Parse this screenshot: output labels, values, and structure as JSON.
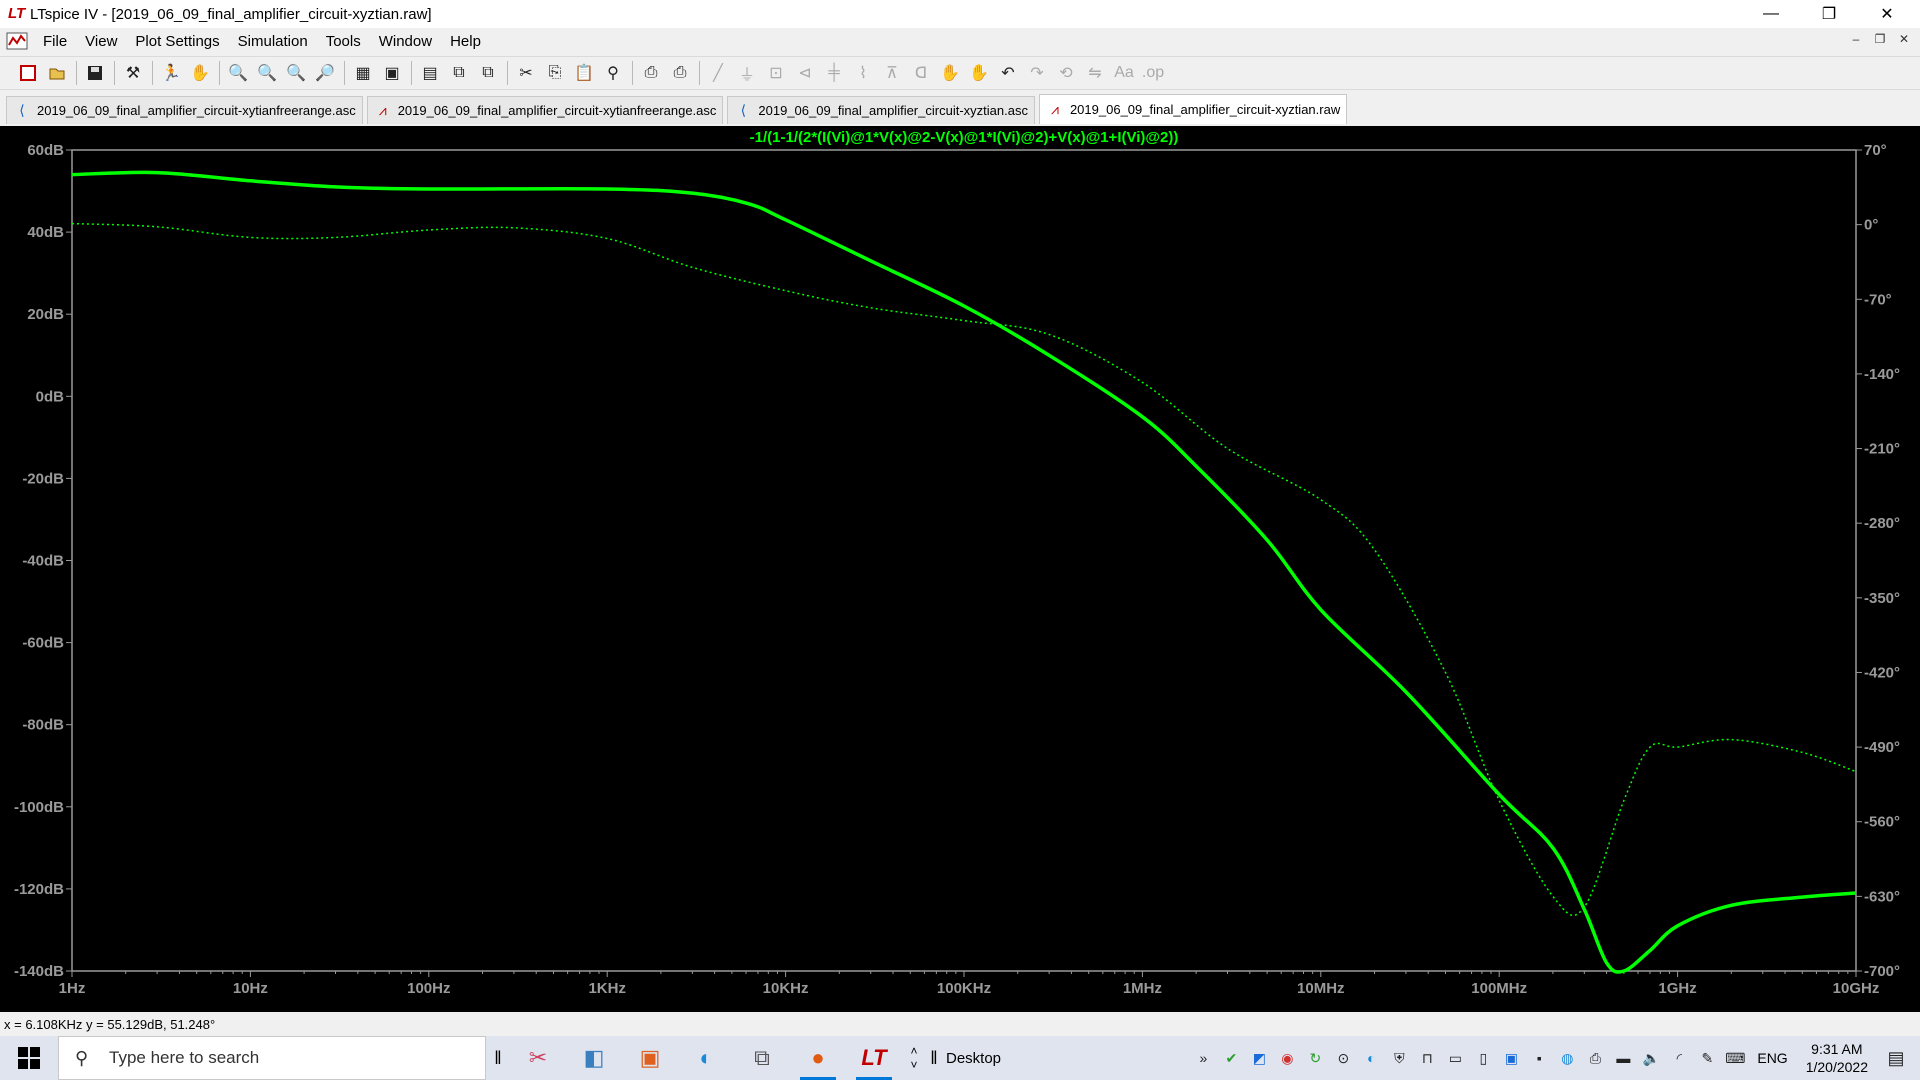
{
  "window": {
    "title": "LTspice IV - [2019_06_09_final_amplifier_circuit-xyztian.raw]",
    "controls": [
      "—",
      "❐",
      "✕"
    ],
    "mdi_controls": [
      "–",
      "❐",
      "✕"
    ]
  },
  "menu": {
    "items": [
      "File",
      "View",
      "Plot Settings",
      "Simulation",
      "Tools",
      "Window",
      "Help"
    ]
  },
  "tabs": [
    {
      "label": "2019_06_09_final_amplifier_circuit-xytianfreerange.asc",
      "icon": "schematic-icon",
      "active": false
    },
    {
      "label": "2019_06_09_final_amplifier_circuit-xytianfreerange.asc",
      "icon": "waveform-icon",
      "active": false
    },
    {
      "label": "2019_06_09_final_amplifier_circuit-xyztian.asc",
      "icon": "schematic-icon",
      "active": false
    },
    {
      "label": "2019_06_09_final_amplifier_circuit-xyztian.raw",
      "icon": "waveform-icon",
      "active": true
    }
  ],
  "plot": {
    "trace_label": "-1/(1-1/(2*(I(Vi)@1*V(x)@2-V(x)@1*I(Vi)@2)+V(x)@1+I(Vi)@2))",
    "trace_color": "#00ff00",
    "grid_color": "#00ff00",
    "background": "#000000"
  },
  "chart_data": {
    "type": "line",
    "x_scale": "log",
    "xlim": [
      1,
      10000000000
    ],
    "x_ticks": [
      {
        "v": 1,
        "label": "1Hz"
      },
      {
        "v": 10,
        "label": "10Hz"
      },
      {
        "v": 100,
        "label": "100Hz"
      },
      {
        "v": 1000,
        "label": "1KHz"
      },
      {
        "v": 10000,
        "label": "10KHz"
      },
      {
        "v": 100000,
        "label": "100KHz"
      },
      {
        "v": 1000000,
        "label": "1MHz"
      },
      {
        "v": 10000000,
        "label": "10MHz"
      },
      {
        "v": 100000000,
        "label": "100MHz"
      },
      {
        "v": 1000000000,
        "label": "1GHz"
      },
      {
        "v": 10000000000,
        "label": "10GHz"
      }
    ],
    "ylim_left": [
      -140,
      60
    ],
    "y_ticks_left": [
      {
        "v": 60,
        "label": "60dB"
      },
      {
        "v": 40,
        "label": "40dB"
      },
      {
        "v": 20,
        "label": "20dB"
      },
      {
        "v": 0,
        "label": "0dB"
      },
      {
        "v": -20,
        "label": "-20dB"
      },
      {
        "v": -40,
        "label": "-40dB"
      },
      {
        "v": -60,
        "label": "-60dB"
      },
      {
        "v": -80,
        "label": "-80dB"
      },
      {
        "v": -100,
        "label": "-100dB"
      },
      {
        "v": -120,
        "label": "-120dB"
      },
      {
        "v": -140,
        "label": "-140dB"
      }
    ],
    "ylim_right": [
      -700,
      70
    ],
    "y_ticks_right": [
      {
        "v": 70,
        "label": "70°"
      },
      {
        "v": 0,
        "label": "0°"
      },
      {
        "v": -70,
        "label": "-70°"
      },
      {
        "v": -140,
        "label": "-140°"
      },
      {
        "v": -210,
        "label": "-210°"
      },
      {
        "v": -280,
        "label": "-280°"
      },
      {
        "v": -350,
        "label": "-350°"
      },
      {
        "v": -420,
        "label": "-420°"
      },
      {
        "v": -490,
        "label": "-490°"
      },
      {
        "v": -560,
        "label": "-560°"
      },
      {
        "v": -630,
        "label": "-630°"
      },
      {
        "v": -700,
        "label": "-700°"
      }
    ],
    "series": [
      {
        "style": "solid",
        "axis": "left",
        "points": [
          [
            1,
            54
          ],
          [
            3,
            54.5
          ],
          [
            10,
            52.5
          ],
          [
            30,
            51
          ],
          [
            100,
            50.5
          ],
          [
            1000,
            50.5
          ],
          [
            3000,
            49.5
          ],
          [
            6108,
            47
          ],
          [
            10000,
            43
          ],
          [
            30000,
            33
          ],
          [
            100000,
            22
          ],
          [
            300000,
            10
          ],
          [
            1000000,
            -5
          ],
          [
            2000000,
            -17
          ],
          [
            5000000,
            -35
          ],
          [
            10000000,
            -52
          ],
          [
            30000000,
            -72
          ],
          [
            100000000,
            -97
          ],
          [
            200000000,
            -110
          ],
          [
            300000000,
            -125
          ],
          [
            400000000,
            -138
          ],
          [
            500000000,
            -140
          ],
          [
            700000000,
            -135
          ],
          [
            1000000000,
            -129
          ],
          [
            2000000000,
            -124
          ],
          [
            5000000000,
            -122
          ],
          [
            10000000000,
            -121
          ]
        ]
      },
      {
        "style": "dotted",
        "axis": "right",
        "points": [
          [
            1,
            1
          ],
          [
            3,
            -2
          ],
          [
            10,
            -12
          ],
          [
            30,
            -12
          ],
          [
            100,
            -5
          ],
          [
            300,
            -3
          ],
          [
            1000,
            -13
          ],
          [
            3000,
            -40
          ],
          [
            10000,
            -62
          ],
          [
            30000,
            -78
          ],
          [
            100000,
            -90
          ],
          [
            300000,
            -103
          ],
          [
            1000000,
            -148
          ],
          [
            3000000,
            -210
          ],
          [
            10000000,
            -258
          ],
          [
            20000000,
            -305
          ],
          [
            50000000,
            -420
          ],
          [
            100000000,
            -540
          ],
          [
            200000000,
            -630
          ],
          [
            300000000,
            -640
          ],
          [
            500000000,
            -540
          ],
          [
            700000000,
            -490
          ],
          [
            1000000000,
            -490
          ],
          [
            2000000000,
            -483
          ],
          [
            5000000000,
            -495
          ],
          [
            10000000000,
            -513
          ]
        ]
      }
    ]
  },
  "status": {
    "cursor_readout": "x = 6.108KHz     y = 55.129dB, 51.248°"
  },
  "taskbar": {
    "search_placeholder": "Type here to search",
    "desktop_label": "Desktop",
    "language": "ENG",
    "time": "9:31 AM",
    "date": "1/20/2022"
  }
}
